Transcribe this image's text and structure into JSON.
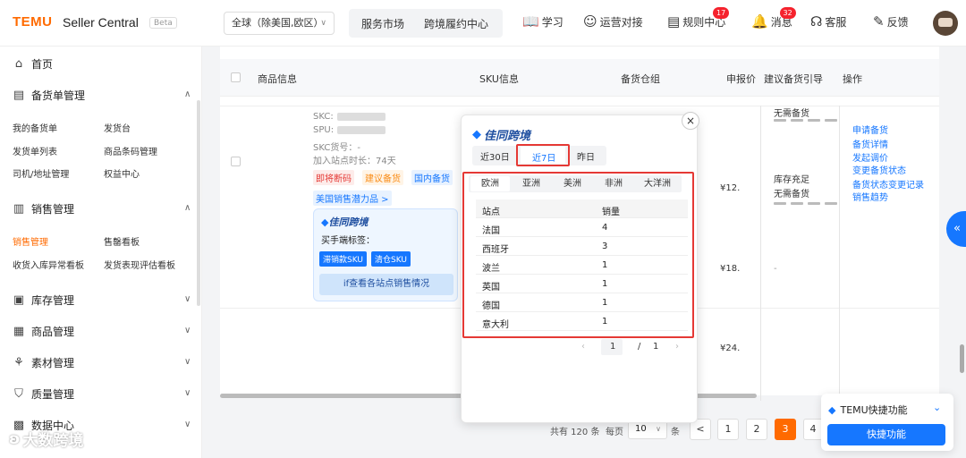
{
  "header": {
    "logo": "TEMU",
    "logo_sub": "Seller Central",
    "beta": "Beta",
    "region": "全球（除美国,欧区）",
    "nav": [
      "服务市场",
      "跨境履约中心"
    ],
    "tools": [
      {
        "label": "学习",
        "icon": "book-icon"
      },
      {
        "label": "运营对接",
        "icon": "chat-icon"
      },
      {
        "label": "规则中心",
        "icon": "rules-icon",
        "badge": "17"
      },
      {
        "label": "消息",
        "icon": "bell-icon",
        "badge": "32"
      },
      {
        "label": "客服",
        "icon": "headset-icon"
      },
      {
        "label": "反馈",
        "icon": "feedback-icon"
      }
    ]
  },
  "sidebar": {
    "home": "首页",
    "sections": [
      {
        "label": "备货单管理",
        "items": [
          "我的备货单",
          "发货台",
          "发货单列表",
          "商品条码管理",
          "司机/地址管理",
          "权益中心"
        ]
      },
      {
        "label": "销售管理",
        "items": [
          "销售管理",
          "售罄看板",
          "收货入库异常看板",
          "发货表现评估看板"
        ]
      },
      {
        "label": "库存管理"
      },
      {
        "label": "商品管理"
      },
      {
        "label": "素材管理"
      },
      {
        "label": "质量管理"
      },
      {
        "label": "数据中心"
      }
    ]
  },
  "table": {
    "headers": [
      "商品信息",
      "SKU信息",
      "备货仓组",
      "申报价",
      "建议备货引导",
      "操作"
    ],
    "row1": {
      "skc": "SKC:",
      "spu": "SPU:",
      "skc_no": "SKC货号：-",
      "days": "加入站点时长：74天",
      "tags": [
        "即将断码",
        "建议备货",
        "国内备货"
      ],
      "potential": "美国销售潜力品 >"
    },
    "card": {
      "title": "佳同跨境",
      "label": "买手端标签：",
      "btn1": "滞销款SKU",
      "btn2": "清仓SKU",
      "view": "if查看各站点销售情况"
    },
    "prices": [
      "¥12.",
      "¥18.",
      "¥24."
    ],
    "guides": [
      "无需备货",
      "库存充足",
      "无需备货",
      "-"
    ],
    "actions": [
      "申请备货",
      "备货详情",
      "发起调价",
      "变更备货状态",
      "备货状态变更记录",
      "销售趋势"
    ]
  },
  "popup": {
    "title": "佳同跨境",
    "close": "×",
    "tabs": [
      "近30日",
      "近7日",
      "昨日"
    ],
    "active_tab": "近7日",
    "continents": [
      "欧洲",
      "亚洲",
      "美洲",
      "非洲",
      "大洋洲"
    ],
    "active_continent": "欧洲",
    "columns": [
      "站点",
      "销量"
    ],
    "rows": [
      {
        "site": "法国",
        "qty": "4"
      },
      {
        "site": "西班牙",
        "qty": "3"
      },
      {
        "site": "波兰",
        "qty": "1"
      },
      {
        "site": "英国",
        "qty": "1"
      },
      {
        "site": "德国",
        "qty": "1"
      },
      {
        "site": "意大利",
        "qty": "1"
      }
    ],
    "page": "1",
    "total_pages": "1",
    "prev": "‹",
    "next": "›",
    "sep": "/"
  },
  "pagination": {
    "total": "共有 120 条",
    "per_page_label": "每页",
    "per_page": "10",
    "unit": "条",
    "pages": [
      "1",
      "2",
      "3",
      "4"
    ],
    "current": "3",
    "prev": "<"
  },
  "quick": {
    "title": "TEMU快捷功能",
    "button": "快捷功能"
  },
  "watermark": "大数跨境"
}
